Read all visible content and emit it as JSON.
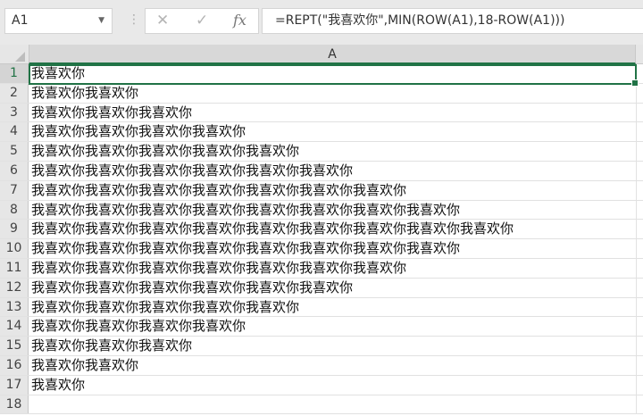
{
  "name_box": {
    "value": "A1"
  },
  "formula_bar": {
    "cancel_icon": "✕",
    "enter_icon": "✓",
    "fx_label": "fx",
    "formula": "=REPT(\"我喜欢你\",MIN(ROW(A1),18-ROW(A1)))"
  },
  "columns": [
    "A"
  ],
  "rows": [
    {
      "n": "1",
      "v": "我喜欢你"
    },
    {
      "n": "2",
      "v": "我喜欢你我喜欢你"
    },
    {
      "n": "3",
      "v": "我喜欢你我喜欢你我喜欢你"
    },
    {
      "n": "4",
      "v": "我喜欢你我喜欢你我喜欢你我喜欢你"
    },
    {
      "n": "5",
      "v": "我喜欢你我喜欢你我喜欢你我喜欢你我喜欢你"
    },
    {
      "n": "6",
      "v": "我喜欢你我喜欢你我喜欢你我喜欢你我喜欢你我喜欢你"
    },
    {
      "n": "7",
      "v": "我喜欢你我喜欢你我喜欢你我喜欢你我喜欢你我喜欢你我喜欢你"
    },
    {
      "n": "8",
      "v": "我喜欢你我喜欢你我喜欢你我喜欢你我喜欢你我喜欢你我喜欢你我喜欢你"
    },
    {
      "n": "9",
      "v": "我喜欢你我喜欢你我喜欢你我喜欢你我喜欢你我喜欢你我喜欢你我喜欢你我喜欢你"
    },
    {
      "n": "10",
      "v": "我喜欢你我喜欢你我喜欢你我喜欢你我喜欢你我喜欢你我喜欢你我喜欢你"
    },
    {
      "n": "11",
      "v": "我喜欢你我喜欢你我喜欢你我喜欢你我喜欢你我喜欢你我喜欢你"
    },
    {
      "n": "12",
      "v": "我喜欢你我喜欢你我喜欢你我喜欢你我喜欢你我喜欢你"
    },
    {
      "n": "13",
      "v": "我喜欢你我喜欢你我喜欢你我喜欢你我喜欢你"
    },
    {
      "n": "14",
      "v": "我喜欢你我喜欢你我喜欢你我喜欢你"
    },
    {
      "n": "15",
      "v": "我喜欢你我喜欢你我喜欢你"
    },
    {
      "n": "16",
      "v": "我喜欢你我喜欢你"
    },
    {
      "n": "17",
      "v": "我喜欢你"
    },
    {
      "n": "18",
      "v": ""
    }
  ]
}
